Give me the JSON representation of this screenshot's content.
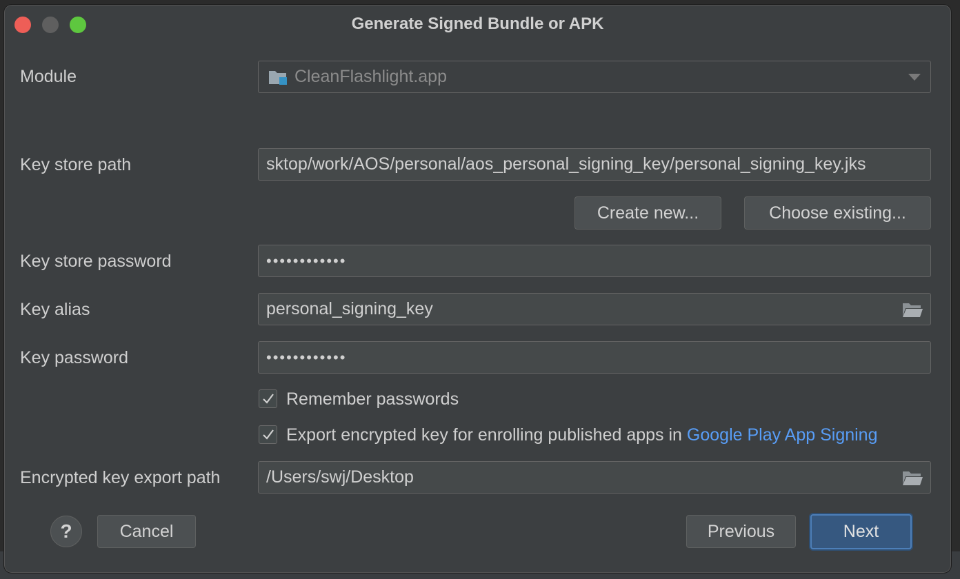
{
  "window": {
    "title": "Generate Signed Bundle or APK"
  },
  "module": {
    "label": "Module",
    "value": "CleanFlashlight.app"
  },
  "keystore": {
    "path_label": "Key store path",
    "path_value": "sktop/work/AOS/personal/aos_personal_signing_key/personal_signing_key.jks",
    "create_new": "Create new...",
    "choose_existing": "Choose existing...",
    "password_label": "Key store password",
    "password_value": "••••••••••••"
  },
  "key": {
    "alias_label": "Key alias",
    "alias_value": "personal_signing_key",
    "password_label": "Key password",
    "password_value": "••••••••••••"
  },
  "options": {
    "remember_passwords": "Remember passwords",
    "remember_checked": true,
    "export_prefix": "Export encrypted key for enrolling published apps in ",
    "export_link": "Google Play App Signing",
    "export_checked": true
  },
  "export": {
    "path_label": "Encrypted key export path",
    "path_value": "/Users/swj/Desktop"
  },
  "footer": {
    "help": "?",
    "cancel": "Cancel",
    "previous": "Previous",
    "next": "Next"
  },
  "colors": {
    "dialog_bg": "#3c3f41",
    "field_bg": "#45494a",
    "primary_button": "#365880",
    "link": "#589df6",
    "close": "#ee5e57",
    "maximize": "#5ec73f"
  }
}
